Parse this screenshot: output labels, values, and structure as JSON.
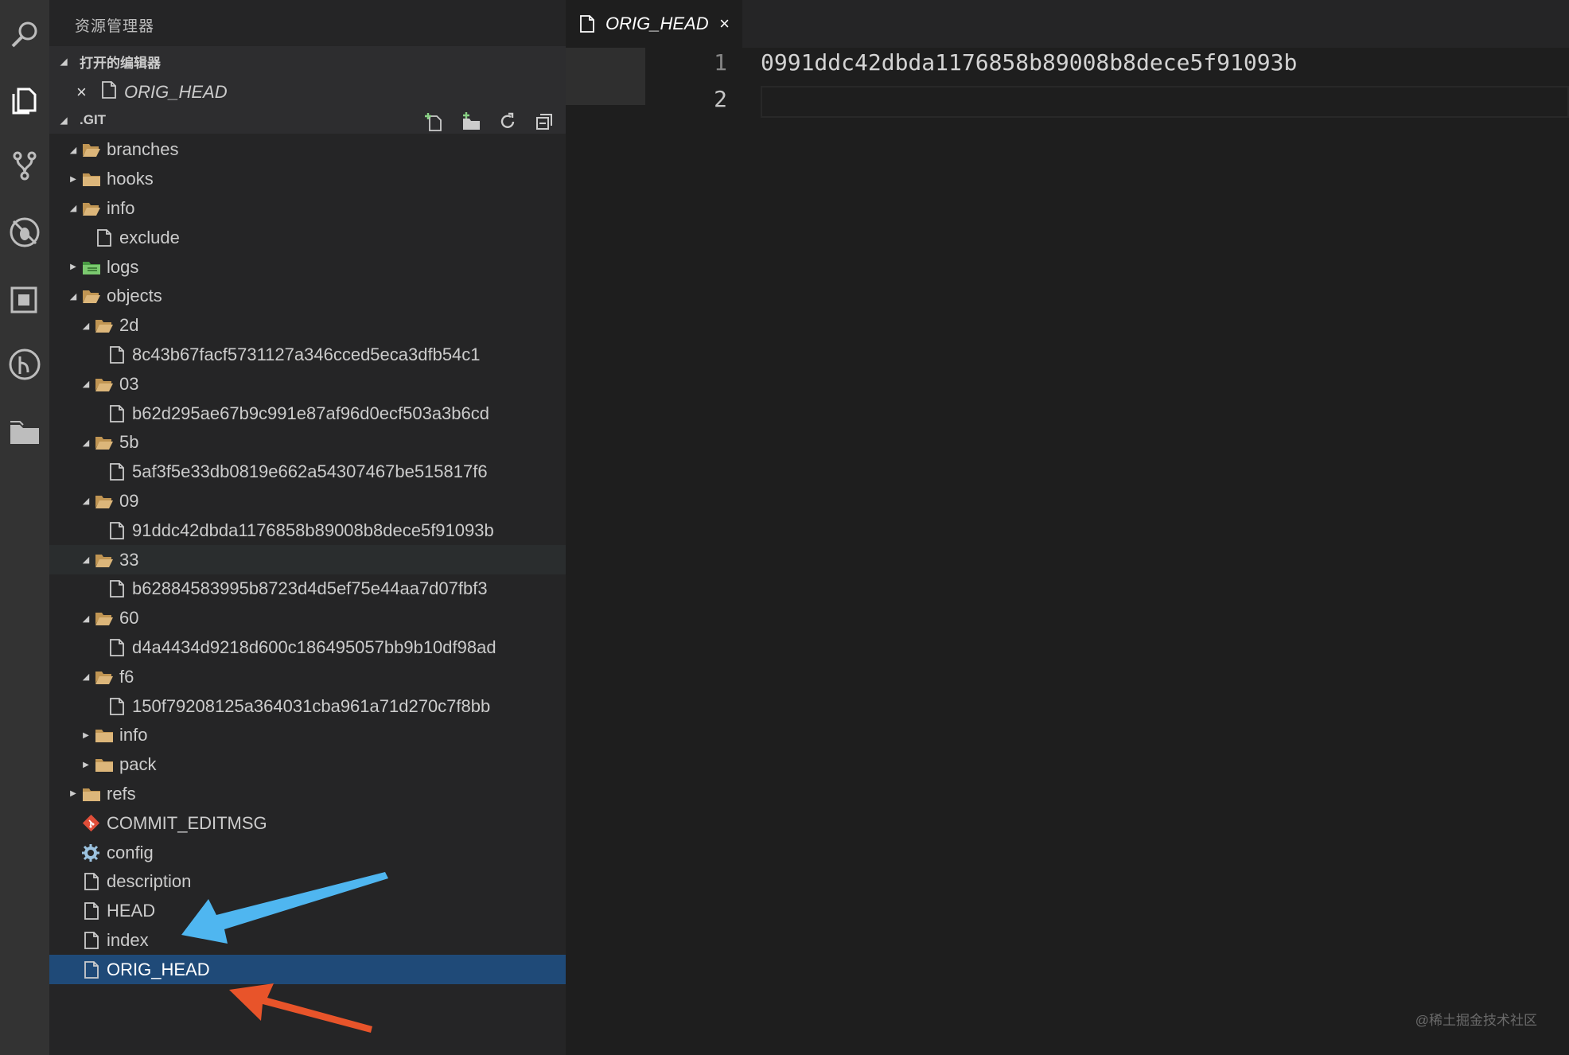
{
  "activity_bar": {
    "icons": [
      "search-icon",
      "files-icon",
      "source-control-icon",
      "debug-icon",
      "extensions-icon",
      "git-history-icon",
      "folder-icon"
    ]
  },
  "sidebar": {
    "title": "资源管理器",
    "open_editors": {
      "header": "打开的编辑器",
      "items": [
        {
          "label": "ORIG_HEAD",
          "close": "×"
        }
      ]
    },
    "folder": {
      "header": ".GIT",
      "actions": [
        "new-file-icon",
        "new-folder-icon",
        "refresh-icon",
        "collapse-all-icon"
      ]
    },
    "tree": [
      {
        "label": "branches",
        "depth": 0,
        "kind": "folder",
        "expanded": true
      },
      {
        "label": "hooks",
        "depth": 0,
        "kind": "folder",
        "expanded": false
      },
      {
        "label": "info",
        "depth": 0,
        "kind": "folder",
        "expanded": true
      },
      {
        "label": "exclude",
        "depth": 1,
        "kind": "file"
      },
      {
        "label": "logs",
        "depth": 0,
        "kind": "folder-green",
        "expanded": false
      },
      {
        "label": "objects",
        "depth": 0,
        "kind": "folder",
        "expanded": true
      },
      {
        "label": "2d",
        "depth": 1,
        "kind": "folder",
        "expanded": true
      },
      {
        "label": "8c43b67facf5731127a346cced5eca3dfb54c1",
        "depth": 2,
        "kind": "file"
      },
      {
        "label": "03",
        "depth": 1,
        "kind": "folder",
        "expanded": true
      },
      {
        "label": "b62d295ae67b9c991e87af96d0ecf503a3b6cd",
        "depth": 2,
        "kind": "file"
      },
      {
        "label": "5b",
        "depth": 1,
        "kind": "folder",
        "expanded": true
      },
      {
        "label": "5af3f5e33db0819e662a54307467be515817f6",
        "depth": 2,
        "kind": "file"
      },
      {
        "label": "09",
        "depth": 1,
        "kind": "folder",
        "expanded": true
      },
      {
        "label": "91ddc42dbda1176858b89008b8dece5f91093b",
        "depth": 2,
        "kind": "file"
      },
      {
        "label": "33",
        "depth": 1,
        "kind": "folder",
        "expanded": true,
        "state": "hover"
      },
      {
        "label": "b62884583995b8723d4d5ef75e44aa7d07fbf3",
        "depth": 2,
        "kind": "file"
      },
      {
        "label": "60",
        "depth": 1,
        "kind": "folder",
        "expanded": true
      },
      {
        "label": "d4a4434d9218d600c186495057bb9b10df98ad",
        "depth": 2,
        "kind": "file"
      },
      {
        "label": "f6",
        "depth": 1,
        "kind": "folder",
        "expanded": true
      },
      {
        "label": "150f79208125a364031cba961a71d270c7f8bb",
        "depth": 2,
        "kind": "file"
      },
      {
        "label": "info",
        "depth": 1,
        "kind": "folder",
        "expanded": false
      },
      {
        "label": "pack",
        "depth": 1,
        "kind": "folder",
        "expanded": false
      },
      {
        "label": "refs",
        "depth": 0,
        "kind": "folder",
        "expanded": false
      },
      {
        "label": "COMMIT_EDITMSG",
        "depth": 0,
        "kind": "git-file"
      },
      {
        "label": "config",
        "depth": 0,
        "kind": "gear-file"
      },
      {
        "label": "description",
        "depth": 0,
        "kind": "file"
      },
      {
        "label": "HEAD",
        "depth": 0,
        "kind": "file"
      },
      {
        "label": "index",
        "depth": 0,
        "kind": "file"
      },
      {
        "label": "ORIG_HEAD",
        "depth": 0,
        "kind": "file",
        "state": "selected"
      }
    ]
  },
  "editor": {
    "tab": {
      "label": "ORIG_HEAD",
      "close": "×"
    },
    "lines": [
      {
        "number": "1",
        "text": "0991ddc42dbda1176858b89008b8dece5f91093b"
      },
      {
        "number": "2",
        "text": ""
      }
    ]
  },
  "annotations": {
    "blue_arrow_color": "#4fb6f0",
    "red_arrow_color": "#e8542a"
  },
  "watermark": "@稀土掘金技术社区"
}
